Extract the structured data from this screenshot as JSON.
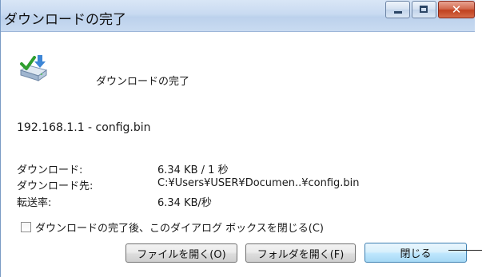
{
  "window": {
    "title": "ダウンロードの完了"
  },
  "header": {
    "icon": "download-complete-icon",
    "text": "ダウンロードの完了"
  },
  "source": "192.168.1.1 - config.bin",
  "details": {
    "downloaded_label": "ダウンロード:",
    "downloaded_value": "6.34 KB / 1 秒",
    "destination_label": "ダウンロード先:",
    "destination_value": "C:¥Users¥USER¥Documen..¥config.bin",
    "rate_label": "転送率:",
    "rate_value": "6.34 KB/秒"
  },
  "checkbox": {
    "label": "ダウンロードの完了後、このダイアログ ボックスを閉じる(C)",
    "checked": false
  },
  "buttons": {
    "open_file": "ファイルを開く(O)",
    "open_folder": "フォルダを開く(F)",
    "close": "閉じる"
  }
}
